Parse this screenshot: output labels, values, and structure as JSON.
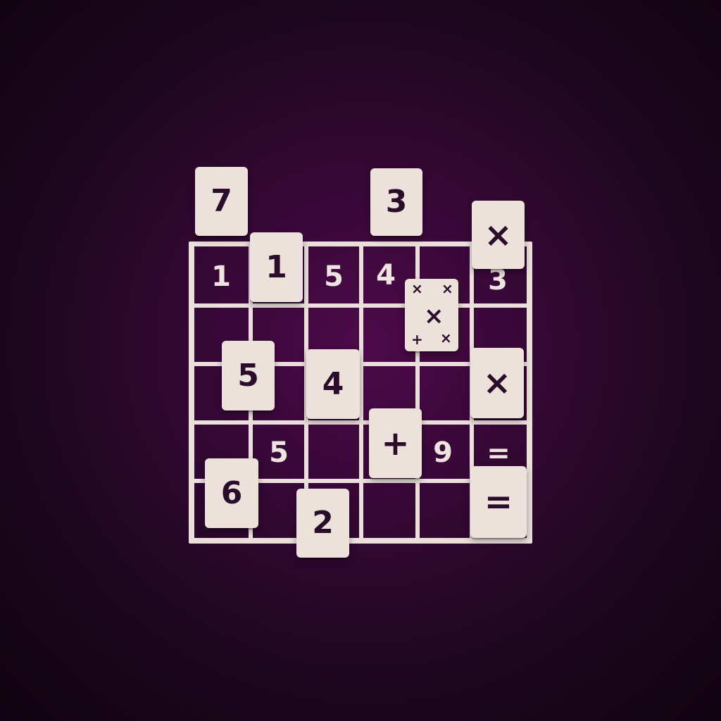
{
  "board": {
    "rows": 5,
    "cols": 6,
    "line_color": "#eadfdb",
    "cell_values": [
      {
        "text": "1",
        "cell": "r1c1"
      },
      {
        "text": "5",
        "cell": "r1c3"
      },
      {
        "text": "4",
        "cell": "r1c4"
      },
      {
        "text": "3",
        "cell": "r1c6"
      },
      {
        "text": "5",
        "cell": "r4c2"
      },
      {
        "text": "9",
        "cell": "r4c5"
      },
      {
        "text": "=",
        "cell": "r4c6"
      }
    ]
  },
  "tiles": [
    {
      "name": "tile-7",
      "face": "7"
    },
    {
      "name": "tile-3",
      "face": "3"
    },
    {
      "name": "tile-multiply",
      "face": "×"
    },
    {
      "name": "tile-1",
      "face": "1"
    },
    {
      "name": "tile-5",
      "face": "5"
    },
    {
      "name": "tile-4",
      "face": "4"
    },
    {
      "name": "tile-multiply-2",
      "face": "×"
    },
    {
      "name": "tile-plus",
      "face": "+"
    },
    {
      "name": "tile-6",
      "face": "6"
    },
    {
      "name": "tile-2",
      "face": "2"
    },
    {
      "name": "tile-equals",
      "face": "="
    }
  ],
  "wild_tile": {
    "center": "×",
    "corners": [
      "×",
      "×",
      "+",
      "×"
    ]
  },
  "colors": {
    "background_center": "#4e0a4a",
    "background_edge": "#120412",
    "tile_face": "#ece1db",
    "tile_ink": "#2a0d2a"
  }
}
